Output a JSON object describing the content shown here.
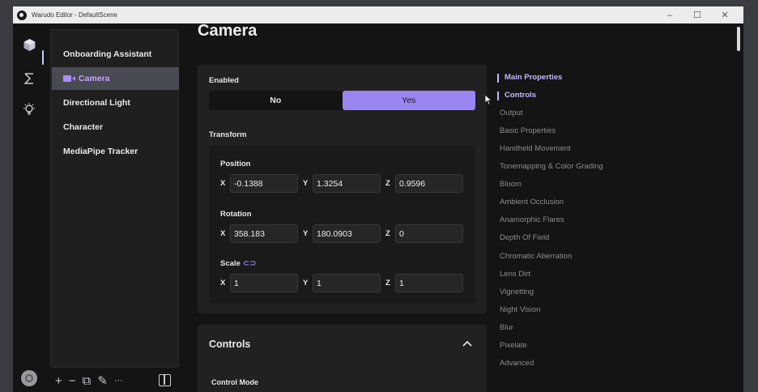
{
  "window": {
    "title": "Warudo Editor - DefaultScene",
    "controls": [
      "–",
      "☐",
      "✕"
    ]
  },
  "rail": {
    "icons": [
      "cube-icon",
      "sigma-icon",
      "lightbulb-icon"
    ]
  },
  "outliner": {
    "items": [
      {
        "label": "Onboarding Assistant",
        "selected": false
      },
      {
        "label": "Camera",
        "selected": true
      },
      {
        "label": "Directional Light",
        "selected": false
      },
      {
        "label": "Character",
        "selected": false
      },
      {
        "label": "MediaPipe Tracker",
        "selected": false
      }
    ],
    "tools": [
      "+",
      "−",
      "⧉",
      "✎",
      "···"
    ]
  },
  "main": {
    "title": "Camera",
    "enabled_label": "Enabled",
    "toggle": {
      "no": "No",
      "yes": "Yes",
      "value": "Yes"
    },
    "transform_label": "Transform",
    "position": {
      "label": "Position",
      "x": "-0.1388",
      "y": "1.3254",
      "z": "0.9596"
    },
    "rotation": {
      "label": "Rotation",
      "x": "358.183",
      "y": "180.0903",
      "z": "0"
    },
    "scale": {
      "label": "Scale",
      "x": "1",
      "y": "1",
      "z": "1"
    },
    "axis": {
      "x": "X",
      "y": "Y",
      "z": "Z"
    },
    "controls": {
      "title": "Controls",
      "control_mode_label": "Control Mode"
    }
  },
  "nav": {
    "items": [
      {
        "label": "Main Properties",
        "active": true
      },
      {
        "label": "Controls",
        "active": true
      },
      {
        "label": "Output",
        "active": false
      },
      {
        "label": "Basic Properties",
        "active": false
      },
      {
        "label": "Handheld Movement",
        "active": false
      },
      {
        "label": "Tonemapping & Color Grading",
        "active": false
      },
      {
        "label": "Bloom",
        "active": false
      },
      {
        "label": "Ambient Occlusion",
        "active": false
      },
      {
        "label": "Anamorphic Flares",
        "active": false
      },
      {
        "label": "Depth Of Field",
        "active": false
      },
      {
        "label": "Chromatic Aberration",
        "active": false
      },
      {
        "label": "Lens Dirt",
        "active": false
      },
      {
        "label": "Vignetting",
        "active": false
      },
      {
        "label": "Night Vision",
        "active": false
      },
      {
        "label": "Blur",
        "active": false
      },
      {
        "label": "Pixelate",
        "active": false
      },
      {
        "label": "Advanced",
        "active": false
      }
    ]
  },
  "colors": {
    "accent": "#9a85f2",
    "accent_text": "#c5b8ff",
    "background": "#141414",
    "panel": "#212121"
  }
}
